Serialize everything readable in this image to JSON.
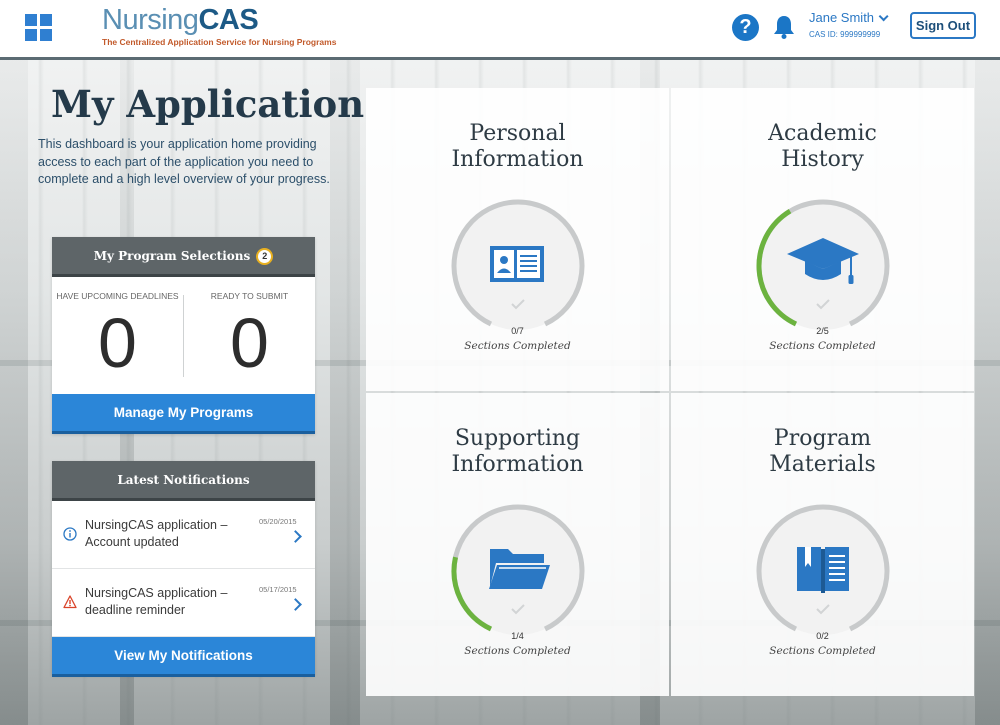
{
  "header": {
    "logo_text_a": "Nursing",
    "logo_text_b": "CAS",
    "logo_tagline": "The Centralized Application Service for Nursing Programs",
    "help_symbol": "?",
    "user_name": "Jane Smith",
    "cas_id": "CAS ID: 999999999",
    "signout_label": "Sign Out"
  },
  "main": {
    "title": "My Application",
    "description": "This dashboard is your application home providing access to each part of the application you need to complete and a high level overview of your progress."
  },
  "programs": {
    "title": "My Program Selections",
    "count": "2",
    "deadlines_label": "Have Upcoming Deadlines",
    "deadlines_value": "0",
    "ready_label": "Ready to Submit",
    "ready_value": "0",
    "manage_button": "Manage My Programs"
  },
  "notifications": {
    "title": "Latest Notifications",
    "items": [
      {
        "text": "NursingCAS application – Account updated",
        "date": "05/20/2015",
        "icon": "info-icon"
      },
      {
        "text": "NursingCAS application – deadline reminder",
        "date": "05/17/2015",
        "icon": "warning-icon"
      }
    ],
    "view_button": "View My Notifications"
  },
  "sections": [
    {
      "title_line1": "Personal",
      "title_line2": "Information",
      "completed": 0,
      "total": 7,
      "count_text": "0/7",
      "caption": "Sections Completed",
      "icon": "id-card-icon"
    },
    {
      "title_line1": "Academic",
      "title_line2": "History",
      "completed": 2,
      "total": 5,
      "count_text": "2/5",
      "caption": "Sections Completed",
      "icon": "graduation-cap-icon"
    },
    {
      "title_line1": "Supporting",
      "title_line2": "Information",
      "completed": 1,
      "total": 4,
      "count_text": "1/4",
      "caption": "Sections Completed",
      "icon": "folder-icon"
    },
    {
      "title_line1": "Program",
      "title_line2": "Materials",
      "completed": 0,
      "total": 2,
      "count_text": "0/2",
      "caption": "Sections Completed",
      "icon": "book-icon"
    }
  ],
  "colors": {
    "accent_blue": "#2b86d8",
    "progress_green": "#6cb33f",
    "ring_grey": "#c8cacb",
    "header_dark": "#5e6568"
  }
}
